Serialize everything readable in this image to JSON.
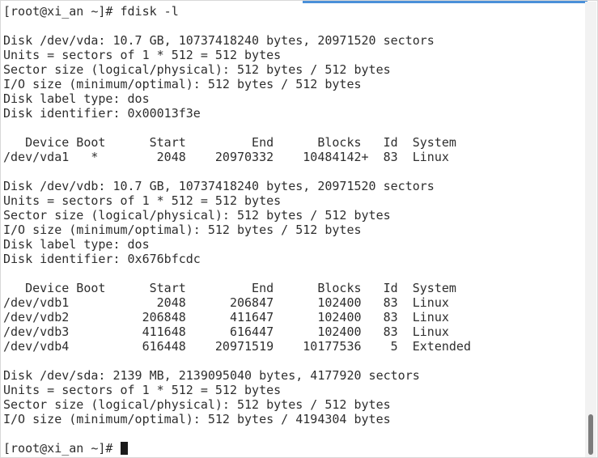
{
  "terminal": {
    "lines": [
      "[root@xi_an ~]# fdisk -l",
      "",
      "Disk /dev/vda: 10.7 GB, 10737418240 bytes, 20971520 sectors",
      "Units = sectors of 1 * 512 = 512 bytes",
      "Sector size (logical/physical): 512 bytes / 512 bytes",
      "I/O size (minimum/optimal): 512 bytes / 512 bytes",
      "Disk label type: dos",
      "Disk identifier: 0x00013f3e",
      "",
      "   Device Boot      Start         End      Blocks   Id  System",
      "/dev/vda1   *        2048    20970332    10484142+  83  Linux",
      "",
      "Disk /dev/vdb: 10.7 GB, 10737418240 bytes, 20971520 sectors",
      "Units = sectors of 1 * 512 = 512 bytes",
      "Sector size (logical/physical): 512 bytes / 512 bytes",
      "I/O size (minimum/optimal): 512 bytes / 512 bytes",
      "Disk label type: dos",
      "Disk identifier: 0x676bfcdc",
      "",
      "   Device Boot      Start         End      Blocks   Id  System",
      "/dev/vdb1            2048      206847      102400   83  Linux",
      "/dev/vdb2          206848      411647      102400   83  Linux",
      "/dev/vdb3          411648      616447      102400   83  Linux",
      "/dev/vdb4          616448    20971519    10177536    5  Extended",
      "",
      "Disk /dev/sda: 2139 MB, 2139095040 bytes, 4177920 sectors",
      "Units = sectors of 1 * 512 = 512 bytes",
      "Sector size (logical/physical): 512 bytes / 512 bytes",
      "I/O size (minimum/optimal): 512 bytes / 4194304 bytes",
      ""
    ],
    "prompt": "[root@xi_an ~]# "
  }
}
